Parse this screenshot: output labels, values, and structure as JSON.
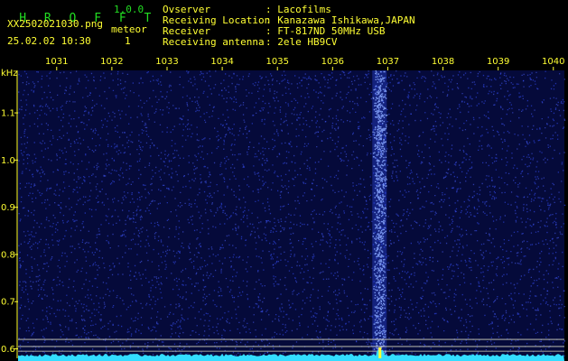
{
  "app": {
    "name": "H R O F F T",
    "version": "1.0.0",
    "filename": "XX2502021030.png",
    "datetime": "25.02.02 10:30",
    "meteor_label": "meteor",
    "meteor_count": "1"
  },
  "station": {
    "rows": [
      {
        "label": "Ovserver",
        "value": ": Lacofilms"
      },
      {
        "label": "Receiving Location",
        "value": ": Kanazawa Ishikawa,JAPAN"
      },
      {
        "label": "Receiver",
        "value": ": FT-817ND 50MHz USB"
      },
      {
        "label": "Receiving antenna",
        "value": ": 2ele HB9CV"
      }
    ]
  },
  "colors": {
    "header_green": "#22dd22",
    "header_yellow": "#ffff33",
    "background": "#000000",
    "noise_blue": "#2a3fd0",
    "signal_cyan": "#33ddff",
    "marker_line": "#d8d8c0"
  },
  "chart_data": {
    "type": "heatmap",
    "x_label": "",
    "y_unit": "kHz",
    "x_ticks": [
      "1031",
      "1032",
      "1033",
      "1034",
      "1035",
      "1036",
      "1037",
      "1038",
      "1039",
      "1040"
    ],
    "y_ticks": [
      "1.1",
      "1.0",
      "0.9",
      "0.8",
      "0.7",
      "0.6"
    ],
    "y_range": [
      0.58,
      1.19
    ],
    "x_range": [
      1030.3,
      1040.2
    ],
    "meteor_trail_x": 1036.85,
    "horizontal_markers_khz": [
      0.62,
      0.605,
      0.595
    ],
    "grid": false
  }
}
